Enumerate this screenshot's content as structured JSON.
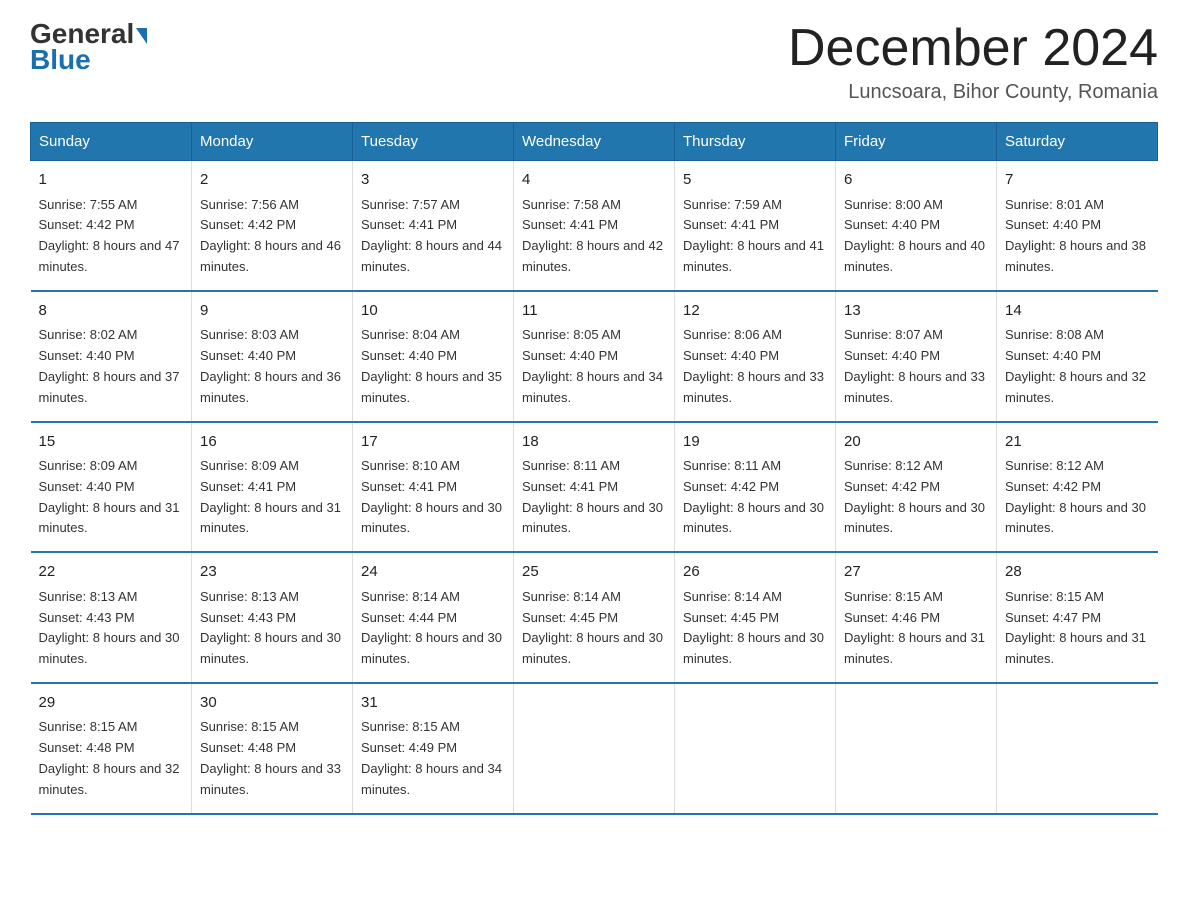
{
  "header": {
    "logo_line1": "General",
    "logo_line2": "Blue",
    "title": "December 2024",
    "subtitle": "Luncsoara, Bihor County, Romania"
  },
  "days_of_week": [
    "Sunday",
    "Monday",
    "Tuesday",
    "Wednesday",
    "Thursday",
    "Friday",
    "Saturday"
  ],
  "weeks": [
    [
      {
        "num": "1",
        "sunrise": "7:55 AM",
        "sunset": "4:42 PM",
        "daylight": "8 hours and 47 minutes."
      },
      {
        "num": "2",
        "sunrise": "7:56 AM",
        "sunset": "4:42 PM",
        "daylight": "8 hours and 46 minutes."
      },
      {
        "num": "3",
        "sunrise": "7:57 AM",
        "sunset": "4:41 PM",
        "daylight": "8 hours and 44 minutes."
      },
      {
        "num": "4",
        "sunrise": "7:58 AM",
        "sunset": "4:41 PM",
        "daylight": "8 hours and 42 minutes."
      },
      {
        "num": "5",
        "sunrise": "7:59 AM",
        "sunset": "4:41 PM",
        "daylight": "8 hours and 41 minutes."
      },
      {
        "num": "6",
        "sunrise": "8:00 AM",
        "sunset": "4:40 PM",
        "daylight": "8 hours and 40 minutes."
      },
      {
        "num": "7",
        "sunrise": "8:01 AM",
        "sunset": "4:40 PM",
        "daylight": "8 hours and 38 minutes."
      }
    ],
    [
      {
        "num": "8",
        "sunrise": "8:02 AM",
        "sunset": "4:40 PM",
        "daylight": "8 hours and 37 minutes."
      },
      {
        "num": "9",
        "sunrise": "8:03 AM",
        "sunset": "4:40 PM",
        "daylight": "8 hours and 36 minutes."
      },
      {
        "num": "10",
        "sunrise": "8:04 AM",
        "sunset": "4:40 PM",
        "daylight": "8 hours and 35 minutes."
      },
      {
        "num": "11",
        "sunrise": "8:05 AM",
        "sunset": "4:40 PM",
        "daylight": "8 hours and 34 minutes."
      },
      {
        "num": "12",
        "sunrise": "8:06 AM",
        "sunset": "4:40 PM",
        "daylight": "8 hours and 33 minutes."
      },
      {
        "num": "13",
        "sunrise": "8:07 AM",
        "sunset": "4:40 PM",
        "daylight": "8 hours and 33 minutes."
      },
      {
        "num": "14",
        "sunrise": "8:08 AM",
        "sunset": "4:40 PM",
        "daylight": "8 hours and 32 minutes."
      }
    ],
    [
      {
        "num": "15",
        "sunrise": "8:09 AM",
        "sunset": "4:40 PM",
        "daylight": "8 hours and 31 minutes."
      },
      {
        "num": "16",
        "sunrise": "8:09 AM",
        "sunset": "4:41 PM",
        "daylight": "8 hours and 31 minutes."
      },
      {
        "num": "17",
        "sunrise": "8:10 AM",
        "sunset": "4:41 PM",
        "daylight": "8 hours and 30 minutes."
      },
      {
        "num": "18",
        "sunrise": "8:11 AM",
        "sunset": "4:41 PM",
        "daylight": "8 hours and 30 minutes."
      },
      {
        "num": "19",
        "sunrise": "8:11 AM",
        "sunset": "4:42 PM",
        "daylight": "8 hours and 30 minutes."
      },
      {
        "num": "20",
        "sunrise": "8:12 AM",
        "sunset": "4:42 PM",
        "daylight": "8 hours and 30 minutes."
      },
      {
        "num": "21",
        "sunrise": "8:12 AM",
        "sunset": "4:42 PM",
        "daylight": "8 hours and 30 minutes."
      }
    ],
    [
      {
        "num": "22",
        "sunrise": "8:13 AM",
        "sunset": "4:43 PM",
        "daylight": "8 hours and 30 minutes."
      },
      {
        "num": "23",
        "sunrise": "8:13 AM",
        "sunset": "4:43 PM",
        "daylight": "8 hours and 30 minutes."
      },
      {
        "num": "24",
        "sunrise": "8:14 AM",
        "sunset": "4:44 PM",
        "daylight": "8 hours and 30 minutes."
      },
      {
        "num": "25",
        "sunrise": "8:14 AM",
        "sunset": "4:45 PM",
        "daylight": "8 hours and 30 minutes."
      },
      {
        "num": "26",
        "sunrise": "8:14 AM",
        "sunset": "4:45 PM",
        "daylight": "8 hours and 30 minutes."
      },
      {
        "num": "27",
        "sunrise": "8:15 AM",
        "sunset": "4:46 PM",
        "daylight": "8 hours and 31 minutes."
      },
      {
        "num": "28",
        "sunrise": "8:15 AM",
        "sunset": "4:47 PM",
        "daylight": "8 hours and 31 minutes."
      }
    ],
    [
      {
        "num": "29",
        "sunrise": "8:15 AM",
        "sunset": "4:48 PM",
        "daylight": "8 hours and 32 minutes."
      },
      {
        "num": "30",
        "sunrise": "8:15 AM",
        "sunset": "4:48 PM",
        "daylight": "8 hours and 33 minutes."
      },
      {
        "num": "31",
        "sunrise": "8:15 AM",
        "sunset": "4:49 PM",
        "daylight": "8 hours and 34 minutes."
      },
      null,
      null,
      null,
      null
    ]
  ]
}
